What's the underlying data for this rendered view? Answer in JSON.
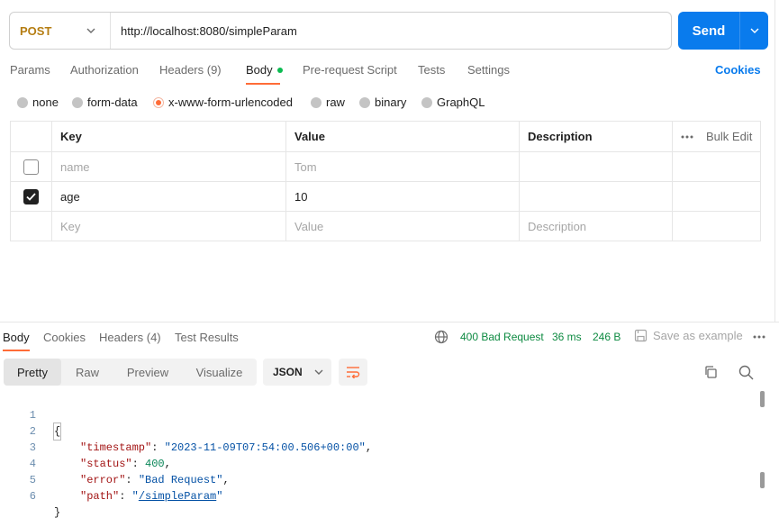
{
  "request": {
    "method": "POST",
    "url": "http://localhost:8080/simpleParam",
    "send_label": "Send"
  },
  "request_tabs": {
    "params": "Params",
    "authorization": "Authorization",
    "headers": "Headers (9)",
    "body": "Body",
    "prerequest": "Pre-request Script",
    "tests": "Tests",
    "settings": "Settings",
    "cookies": "Cookies"
  },
  "body_types": {
    "none": "none",
    "form_data": "form-data",
    "urlencoded": "x-www-form-urlencoded",
    "raw": "raw",
    "binary": "binary",
    "graphql": "GraphQL",
    "selected": "x-www-form-urlencoded"
  },
  "params_table": {
    "headers": {
      "key": "Key",
      "value": "Value",
      "description": "Description",
      "bulk_edit": "Bulk Edit"
    },
    "rows": [
      {
        "checked": false,
        "key": "name",
        "value": "Tom",
        "description": ""
      },
      {
        "checked": true,
        "key": "age",
        "value": "10",
        "description": ""
      }
    ],
    "new_row": {
      "key": "Key",
      "value": "Value",
      "description": "Description"
    }
  },
  "response": {
    "tabs": {
      "body": "Body",
      "cookies": "Cookies",
      "headers": "Headers (4)",
      "test_results": "Test Results"
    },
    "status": "400 Bad Request",
    "time": "36 ms",
    "size": "246 B",
    "save_example": "Save as example",
    "view_tabs": {
      "pretty": "Pretty",
      "raw": "Raw",
      "preview": "Preview",
      "visualize": "Visualize"
    },
    "format": "JSON",
    "code": {
      "line_numbers": [
        "1",
        "2",
        "3",
        "4",
        "5",
        "6"
      ],
      "open_brace": "{",
      "close_brace": "}",
      "timestamp_key": "\"timestamp\"",
      "timestamp_val": "\"2023-11-09T07:54:00.506+00:00\"",
      "status_key": "\"status\"",
      "status_val": "400",
      "error_key": "\"error\"",
      "error_val": "\"Bad Request\"",
      "path_key": "\"path\"",
      "path_val": "/simpleParam"
    }
  },
  "colors": {
    "send": "#097bed",
    "method": "#b57d12",
    "accent": "#ff6c37",
    "status_ok_text": "#0d8a41"
  }
}
